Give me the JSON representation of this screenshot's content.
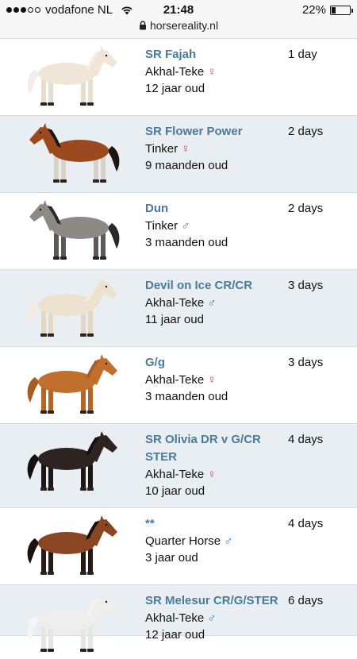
{
  "status_bar": {
    "carrier": "vodafone NL",
    "time": "21:48",
    "battery_percent_text": "22%",
    "battery_level": 0.22
  },
  "url_bar": {
    "domain": "horsereality.nl"
  },
  "horses": [
    {
      "name": "SR Fajah",
      "breed": "Akhal-Teke",
      "gender": "♀",
      "gender_type": "female",
      "age": "12 jaar oud",
      "time": "1 day",
      "coat": "#efe6d8",
      "mane": "#f3eee6",
      "legs": "#e7ddcf"
    },
    {
      "name": "SR Flower Power",
      "breed": "Tinker",
      "gender": "♀",
      "gender_type": "female",
      "age": "9 maanden oud",
      "time": "2 days",
      "coat": "#9a4a1e",
      "mane": "#1e1410",
      "legs": "#d9d2c8"
    },
    {
      "name": "Dun",
      "breed": "Tinker",
      "gender": "♂",
      "gender_type": "male",
      "age": "3 maanden oud",
      "time": "2 days",
      "coat": "#8d8985",
      "mane": "#2b2826",
      "legs": "#5c5955"
    },
    {
      "name": "Devil on Ice CR/CR",
      "breed": "Akhal-Teke",
      "gender": "♂",
      "gender_type": "male",
      "age": "11 jaar oud",
      "time": "3 days",
      "coat": "#ede2d0",
      "mane": "#f2ece2",
      "legs": "#e4d8c4"
    },
    {
      "name": "G/g",
      "breed": "Akhal-Teke",
      "gender": "♀",
      "gender_type": "female",
      "age": "3 maanden oud",
      "time": "3 days",
      "coat": "#c0702c",
      "mane": "#a85c22",
      "legs": "#b66526"
    },
    {
      "name": "SR Olivia DR v G/CR STER",
      "breed": "Akhal-Teke",
      "gender": "♀",
      "gender_type": "female",
      "age": "10 jaar oud",
      "time": "4 days",
      "coat": "#2d2320",
      "mane": "#141010",
      "legs": "#1d1716"
    },
    {
      "name": "**",
      "breed": "Quarter Horse",
      "gender": "♂",
      "gender_type": "male",
      "age": "3 jaar oud",
      "time": "4 days",
      "coat": "#8a4522",
      "mane": "#1a100c",
      "legs": "#2a1a14"
    },
    {
      "name": "SR Melesur CR/G/STER",
      "breed": "Akhal-Teke",
      "gender": "♂",
      "gender_type": "male",
      "age": "12 jaar oud",
      "time": "6 days",
      "coat": "#eeeeec",
      "mane": "#f4f4f2",
      "legs": "#e6e6e3"
    }
  ]
}
